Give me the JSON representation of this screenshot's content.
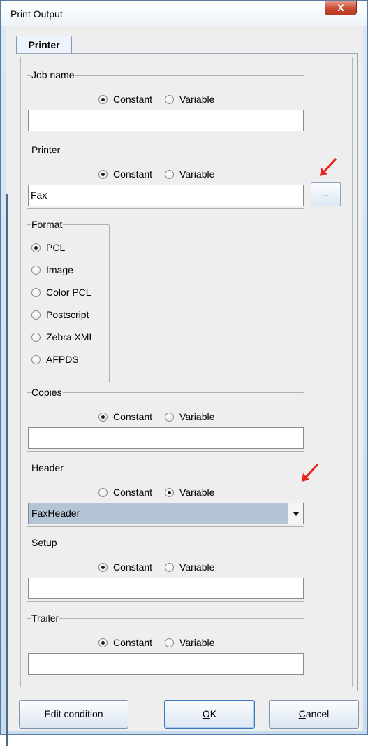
{
  "window": {
    "title": "Print Output",
    "close_glyph": "X"
  },
  "tab": {
    "label": "Printer"
  },
  "radio_options": {
    "constant": "Constant",
    "variable": "Variable"
  },
  "job_name": {
    "legend": "Job name",
    "selected": "Constant",
    "value": ""
  },
  "printer": {
    "legend": "Printer",
    "selected": "Constant",
    "value": "Fax",
    "browse_label": "..."
  },
  "format": {
    "legend": "Format",
    "selected": "PCL",
    "options": [
      "PCL",
      "Image",
      "Color PCL",
      "Postscript",
      "Zebra XML",
      "AFPDS"
    ]
  },
  "copies": {
    "legend": "Copies",
    "selected": "Constant",
    "value": ""
  },
  "header": {
    "legend": "Header",
    "selected": "Variable",
    "value": "FaxHeader"
  },
  "setup": {
    "legend": "Setup",
    "selected": "Constant",
    "value": ""
  },
  "trailer": {
    "legend": "Trailer",
    "selected": "Constant",
    "value": ""
  },
  "buttons": {
    "edit_condition": "Edit condition",
    "ok": {
      "mnemonic": "O",
      "rest": "K"
    },
    "cancel": {
      "mnemonic": "C",
      "rest": "ancel"
    }
  },
  "icons": {
    "close": "close-icon",
    "dropdown": "chevron-down-icon",
    "annotation": "red-arrow-icon"
  },
  "colors": {
    "annotation_arrow": "#e8231c",
    "combo_bg": "#b5c5d6",
    "close_btn": "#c84a34"
  }
}
